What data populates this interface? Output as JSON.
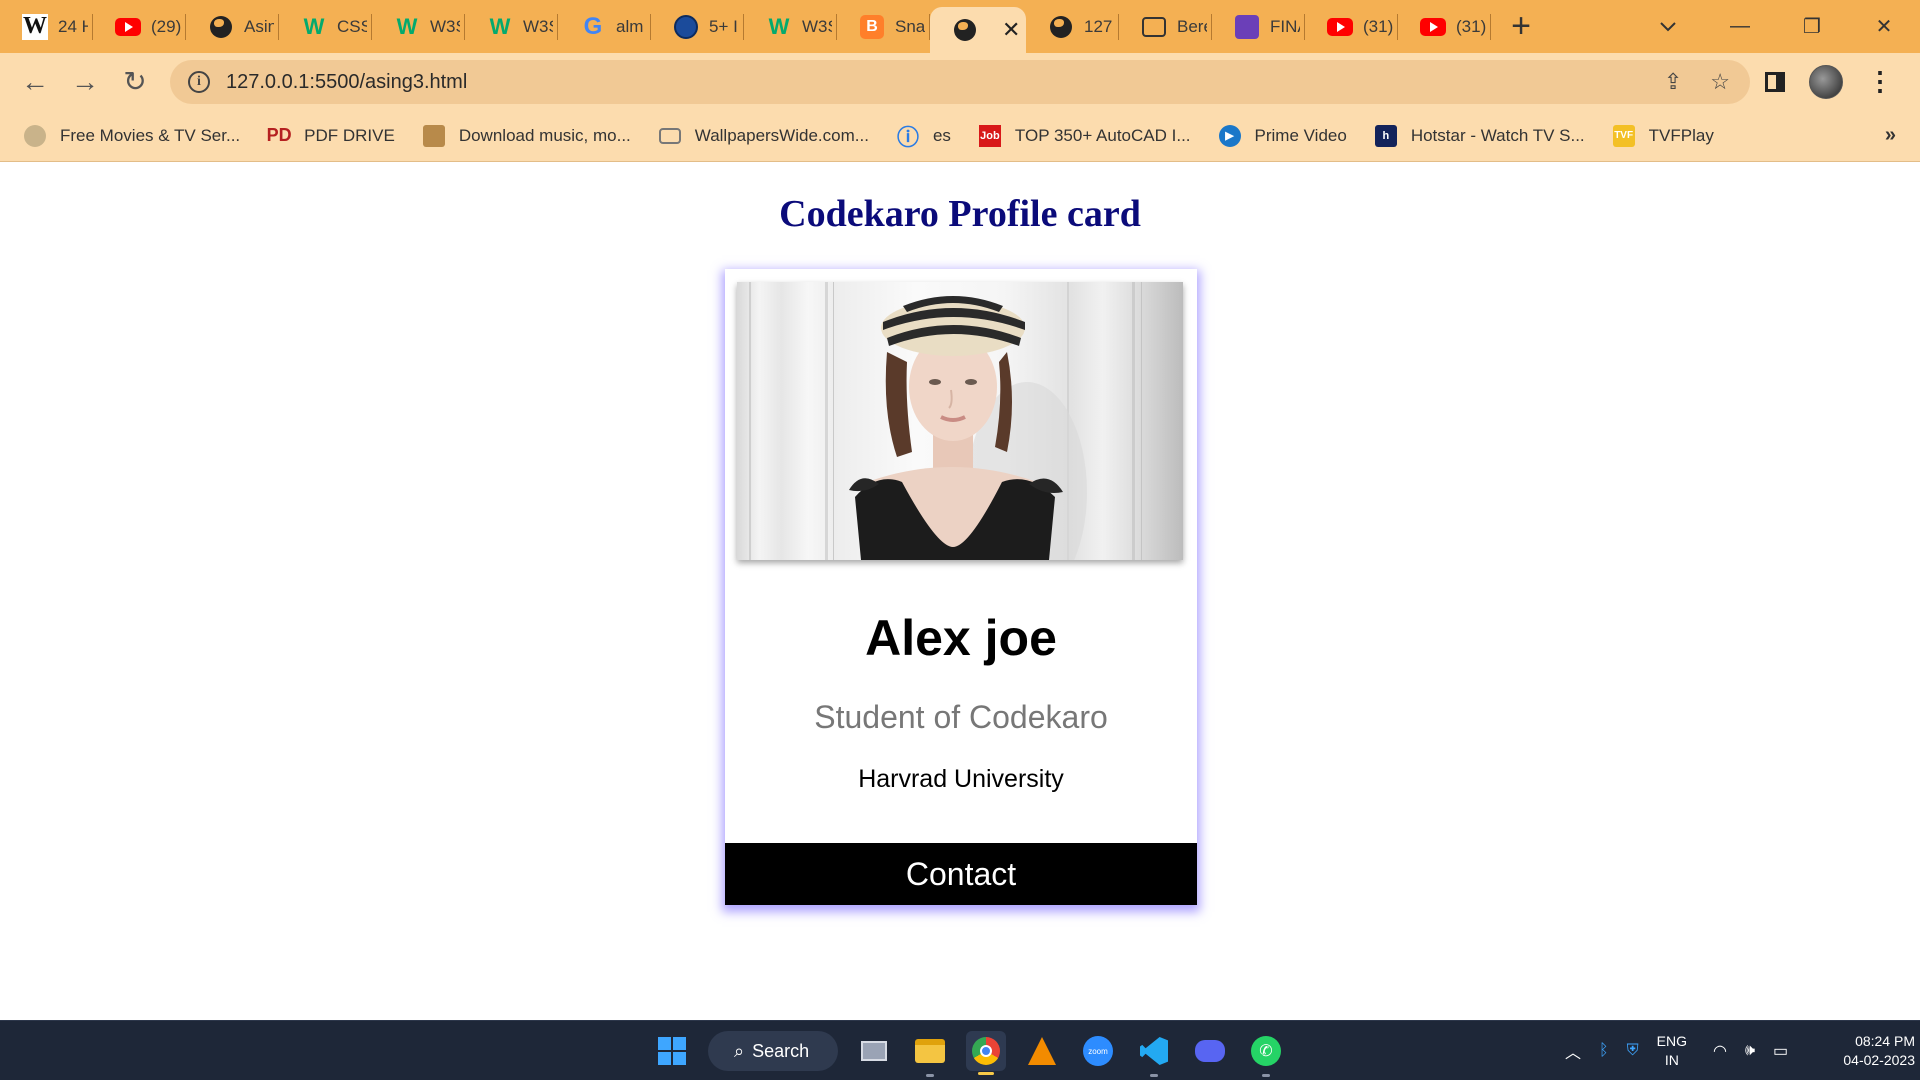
{
  "browser": {
    "tabs": [
      {
        "title": "24 H",
        "icon": "wikipedia-icon"
      },
      {
        "title": "(29)",
        "icon": "youtube-icon"
      },
      {
        "title": "Asin",
        "icon": "globe-icon"
      },
      {
        "title": "CSS",
        "icon": "w3schools-icon"
      },
      {
        "title": "W3S",
        "icon": "w3schools-icon"
      },
      {
        "title": "W3S",
        "icon": "w3schools-icon"
      },
      {
        "title": "alm",
        "icon": "google-icon"
      },
      {
        "title": "5+ I",
        "icon": "user-icon"
      },
      {
        "title": "W3S",
        "icon": "w3schools-icon"
      },
      {
        "title": "Sna",
        "icon": "blogger-icon"
      },
      {
        "title": "",
        "icon": "globe-icon",
        "active": true
      },
      {
        "title": "127",
        "icon": "globe-icon"
      },
      {
        "title": "Bere",
        "icon": "image-icon"
      },
      {
        "title": "FINA",
        "icon": "list-icon"
      },
      {
        "title": "(31)",
        "icon": "youtube-icon"
      },
      {
        "title": "(31)",
        "icon": "youtube-icon"
      }
    ],
    "url": "127.0.0.1:5500/asing3.html",
    "bookmarks": [
      {
        "label": "Free Movies & TV Ser...",
        "icon": "movie-reel-icon"
      },
      {
        "label": "PDF DRIVE",
        "icon": "pdf-drive-icon"
      },
      {
        "label": "Download music, mo...",
        "icon": "download-site-icon"
      },
      {
        "label": "WallpapersWide.com...",
        "icon": "wallpaper-icon"
      },
      {
        "label": "es",
        "icon": "es-icon"
      },
      {
        "label": "TOP 350+ AutoCAD I...",
        "icon": "job-icon"
      },
      {
        "label": "Prime Video",
        "icon": "prime-video-icon"
      },
      {
        "label": "Hotstar - Watch TV S...",
        "icon": "hotstar-icon"
      },
      {
        "label": "TVFPlay",
        "icon": "tvf-icon"
      }
    ]
  },
  "page": {
    "title": "Codekaro Profile card",
    "card": {
      "name": "Alex joe",
      "role": "Student of Codekaro",
      "school": "Harvrad University",
      "button_label": "Contact"
    }
  },
  "taskbar": {
    "search_label": "Search",
    "lang_top": "ENG",
    "lang_bottom": "IN",
    "time": "08:24 PM",
    "date": "04-02-2023"
  }
}
